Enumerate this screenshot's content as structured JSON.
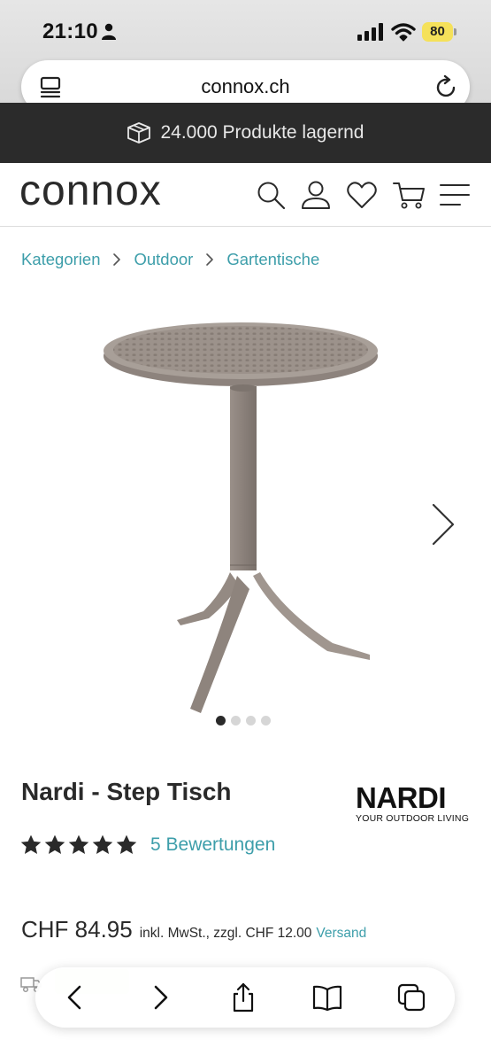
{
  "status_bar": {
    "time": "21:10",
    "battery": "80"
  },
  "browser": {
    "url": "connox.ch"
  },
  "promo": {
    "text": "24.000 Produkte lagernd",
    "icon": "box-icon"
  },
  "header": {
    "logo": "connox",
    "icons": [
      "search-icon",
      "account-icon",
      "wishlist-icon",
      "cart-icon",
      "menu-icon"
    ]
  },
  "breadcrumb": [
    "Kategorien",
    "Outdoor",
    "Gartentische"
  ],
  "gallery": {
    "slide_count": 4,
    "active_slide": 1
  },
  "product": {
    "title": "Nardi - Step Tisch",
    "brand_name": "NARDI",
    "brand_tagline": "YOUR OUTDOOR LIVING",
    "rating": 5,
    "reviews": "5 Bewertungen",
    "price": "CHF 84.95",
    "vat_note": "inkl. MwSt., zzgl. CHF 12.00",
    "shipping_link": "Versand"
  },
  "colors": {
    "accent": "#3d9eaa",
    "promo_bg": "#2b2b2b",
    "text": "#2a2a2a"
  },
  "toolbar": {
    "icons": [
      "back-icon",
      "forward-icon",
      "share-icon",
      "bookmarks-icon",
      "tabs-icon"
    ]
  }
}
